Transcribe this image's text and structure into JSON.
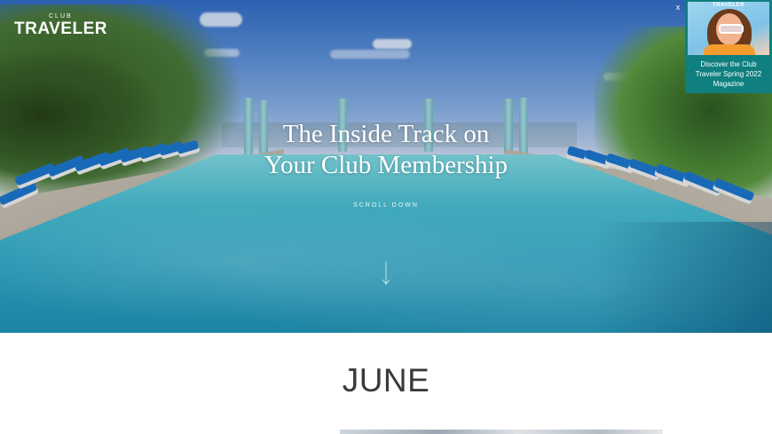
{
  "brand": {
    "logo_prefix": "CLUB",
    "logo_name": "TRAVELER"
  },
  "hero": {
    "headline_line1": "The Inside Track on",
    "headline_line2": "Your Club Membership",
    "scroll_label": "SCROLL DOWN",
    "scroll_icon": "arrow-down-icon"
  },
  "promo": {
    "close_label": "x",
    "cover_title": "TRAVELER",
    "text": "Discover the Club Traveler Spring 2022 Magazine"
  },
  "section": {
    "month_title": "JUNE"
  },
  "colors": {
    "promo_background": "#0f7f80",
    "headline_text": "#ffffff",
    "month_text": "#3a3a3a"
  }
}
